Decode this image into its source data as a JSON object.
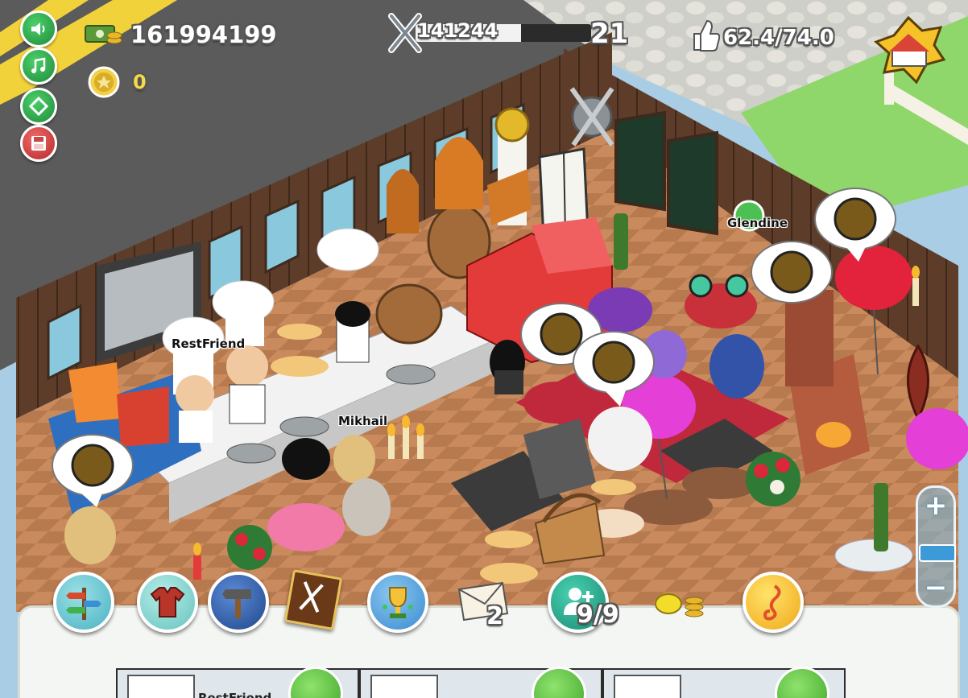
{
  "hud": {
    "cash": "161994199",
    "coins": "0",
    "xp_current": "141244",
    "level": "21",
    "rating": "62.4/74.0",
    "xp_progress_fraction": 0.6
  },
  "side_buttons": [
    "sound-icon",
    "music-icon",
    "fullscreen-icon",
    "save-icon"
  ],
  "toolbar": {
    "mail_count": "2",
    "friends_count": "9/9",
    "items": [
      "signpost-icon",
      "shirt-icon",
      "hammer-icon",
      "menu-book-icon",
      "trophy-icon",
      "mail-icon",
      "add-friend-icon",
      "lemon-icon",
      "music-note-icon"
    ]
  },
  "name_tags": {
    "restfriend": "RestFriend",
    "mikhail": "Mikhail",
    "glendine": "Glendine"
  },
  "friends": [
    {
      "name": "RestFriend"
    },
    {
      "name": ""
    },
    {
      "name": ""
    }
  ],
  "zoom": {
    "plus": "+",
    "minus": "−",
    "level_fraction": 0.5
  },
  "colors": {
    "wall": "#5a3b2a",
    "floor": "#c98b5e",
    "grass": "#8fd66b",
    "hud_green": "#2f9b45",
    "bar_dark": "#2b2b2b"
  }
}
